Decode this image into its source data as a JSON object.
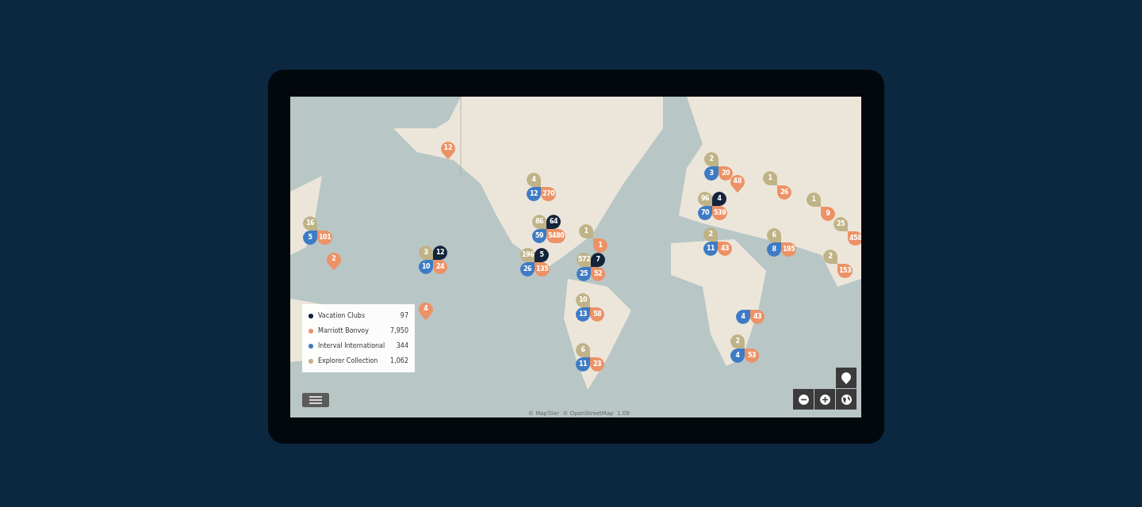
{
  "legend": [
    {
      "kind": "vacation",
      "label": "Vacation Clubs",
      "count": "97",
      "color": "#13243b"
    },
    {
      "kind": "marriott",
      "label": "Marriott Bonvoy",
      "count": "7,950",
      "color": "#ec9266"
    },
    {
      "kind": "interval",
      "label": "Interval International",
      "count": "344",
      "color": "#3e7bc5"
    },
    {
      "kind": "explorer",
      "label": "Explorer Collection",
      "count": "1,062",
      "color": "#bfb387"
    }
  ],
  "clusters": [
    {
      "markers": [
        {
          "kind": "marriott",
          "count": "12"
        }
      ]
    },
    {
      "markers": [
        {
          "kind": "explorer",
          "count": "4"
        },
        {
          "kind": "interval",
          "count": "12"
        },
        {
          "kind": "marriott",
          "count": "270"
        }
      ]
    },
    {
      "markers": [
        {
          "kind": "explorer",
          "count": "16"
        },
        {
          "kind": "interval",
          "count": "5"
        },
        {
          "kind": "marriott",
          "count": "101"
        }
      ]
    },
    {
      "markers": [
        {
          "kind": "marriott",
          "count": "2"
        }
      ]
    },
    {
      "markers": [
        {
          "kind": "explorer",
          "count": "3"
        },
        {
          "kind": "vacation",
          "count": "12"
        },
        {
          "kind": "interval",
          "count": "10"
        },
        {
          "kind": "marriott",
          "count": "24"
        }
      ]
    },
    {
      "markers": [
        {
          "kind": "explorer",
          "count": "86"
        },
        {
          "kind": "vacation",
          "count": "64"
        },
        {
          "kind": "interval",
          "count": "59"
        },
        {
          "kind": "marriott",
          "count": "5480"
        }
      ]
    },
    {
      "markers": [
        {
          "kind": "explorer",
          "count": "196"
        },
        {
          "kind": "vacation",
          "count": "5"
        },
        {
          "kind": "interval",
          "count": "26"
        },
        {
          "kind": "marriott",
          "count": "135"
        }
      ]
    },
    {
      "markers": [
        {
          "kind": "explorer",
          "count": "1"
        },
        {
          "kind": "marriott",
          "count": "1"
        }
      ]
    },
    {
      "markers": [
        {
          "kind": "explorer",
          "count": "572"
        },
        {
          "kind": "vacation",
          "count": "7"
        },
        {
          "kind": "interval",
          "count": "25"
        },
        {
          "kind": "marriott",
          "count": "52"
        }
      ]
    },
    {
      "markers": [
        {
          "kind": "explorer",
          "count": "10"
        },
        {
          "kind": "interval",
          "count": "13"
        },
        {
          "kind": "marriott",
          "count": "58"
        }
      ]
    },
    {
      "markers": [
        {
          "kind": "explorer",
          "count": "6"
        },
        {
          "kind": "interval",
          "count": "11"
        },
        {
          "kind": "marriott",
          "count": "23"
        }
      ]
    },
    {
      "markers": [
        {
          "kind": "marriott",
          "count": "4"
        }
      ]
    },
    {
      "markers": [
        {
          "kind": "explorer",
          "count": "2"
        },
        {
          "kind": "interval",
          "count": "3"
        },
        {
          "kind": "marriott",
          "count": "20"
        }
      ]
    },
    {
      "markers": [
        {
          "kind": "marriott",
          "count": "48"
        }
      ]
    },
    {
      "markers": [
        {
          "kind": "explorer",
          "count": "1"
        },
        {
          "kind": "marriott",
          "count": "26"
        }
      ]
    },
    {
      "markers": [
        {
          "kind": "explorer",
          "count": "96"
        },
        {
          "kind": "vacation",
          "count": "4"
        },
        {
          "kind": "interval",
          "count": "70"
        },
        {
          "kind": "marriott",
          "count": "539"
        }
      ]
    },
    {
      "markers": [
        {
          "kind": "explorer",
          "count": "1"
        },
        {
          "kind": "marriott",
          "count": "9"
        }
      ]
    },
    {
      "markers": [
        {
          "kind": "explorer",
          "count": "2"
        },
        {
          "kind": "interval",
          "count": "11"
        },
        {
          "kind": "marriott",
          "count": "43"
        }
      ]
    },
    {
      "markers": [
        {
          "kind": "explorer",
          "count": "6"
        },
        {
          "kind": "interval",
          "count": "8"
        },
        {
          "kind": "marriott",
          "count": "195"
        }
      ]
    },
    {
      "markers": [
        {
          "kind": "explorer",
          "count": "25"
        },
        {
          "kind": "marriott",
          "count": "458"
        }
      ]
    },
    {
      "markers": [
        {
          "kind": "explorer",
          "count": "2"
        },
        {
          "kind": "marriott",
          "count": "153"
        }
      ]
    },
    {
      "markers": [
        {
          "kind": "interval",
          "count": "4"
        },
        {
          "kind": "marriott",
          "count": "43"
        }
      ]
    },
    {
      "markers": [
        {
          "kind": "explorer",
          "count": "2"
        },
        {
          "kind": "interval",
          "count": "4"
        },
        {
          "kind": "marriott",
          "count": "53"
        }
      ]
    }
  ],
  "attribution": "© MapTiler  © OpenStreetMap  1.09"
}
